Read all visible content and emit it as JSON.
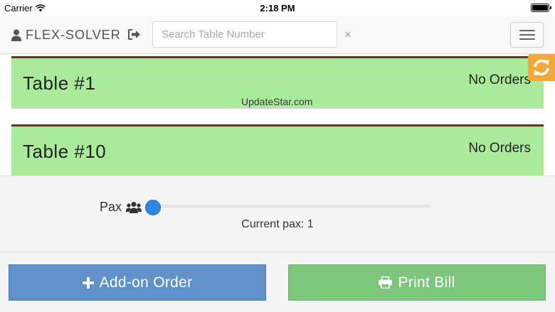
{
  "status_bar": {
    "carrier": "Carrier",
    "time": "2:18 PM",
    "battery_level": 1.0
  },
  "header": {
    "brand": "FLEX-SOLVER",
    "search": {
      "placeholder": "Search Table Number",
      "value": ""
    },
    "clear": "×"
  },
  "tables": [
    {
      "name": "Table #1",
      "status": "No Orders"
    },
    {
      "name": "Table #10",
      "status": "No Orders"
    }
  ],
  "watermark": "UpdateStar.com",
  "pax": {
    "label": "Pax",
    "current_label": "Current pax: 1",
    "value": 1,
    "slider_fraction": 0.0
  },
  "actions": {
    "add_on": "Add-on Order",
    "print": "Print Bill"
  },
  "colors": {
    "table_available": "#a9eb99",
    "table_border": "#5c3c1e",
    "refresh": "#f1aa3a",
    "add_button": "#5e92c9",
    "print_button": "#7cc77b",
    "slider_thumb": "#2f86e0"
  },
  "icons": {
    "brand": "user-icon",
    "logout": "sign-out-icon",
    "refresh": "refresh-icon",
    "pax": "users-icon",
    "add": "plus-icon",
    "print": "print-icon",
    "menu": "hamburger-icon",
    "wifi": "wifi-icon",
    "battery": "battery-icon"
  }
}
